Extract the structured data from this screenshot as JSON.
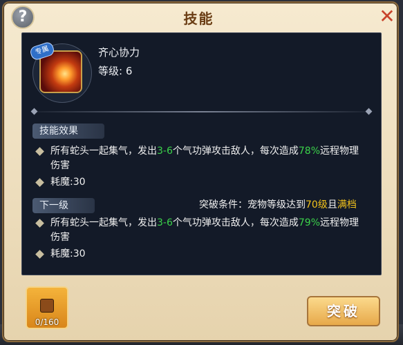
{
  "window": {
    "title": "技能",
    "help_label": "?",
    "close_label": "✕"
  },
  "skill": {
    "badge": "专属",
    "name": "齐心协力",
    "level_label": "等级: 6"
  },
  "sections": {
    "effect": {
      "label": "技能效果",
      "desc_prefix": "所有蛇头一起集气，发出",
      "desc_range": "3-6",
      "desc_mid": "个气功弹攻击敌人，每次造成",
      "desc_pct": "78%",
      "desc_suffix": "远程物理",
      "desc_line2": "伤害",
      "cost": "耗魔:30"
    },
    "next": {
      "label": "下一级",
      "cond_prefix": "突破条件：宠物等级达到",
      "cond_level": "70级",
      "cond_and": "且",
      "cond_full": "满档",
      "desc_prefix": "所有蛇头一起集气，发出",
      "desc_range": "3-6",
      "desc_mid": "个气功弹攻击敌人，每次造成",
      "desc_pct": "79%",
      "desc_suffix": "远程物理",
      "desc_line2": "伤害",
      "cost": "耗魔:30"
    }
  },
  "footer": {
    "item_count": "0/160",
    "break_label": "突破"
  },
  "colors": {
    "highlight_green": "#3bd24a",
    "highlight_yellow": "#f2c21c",
    "title_brown": "#6a3d14"
  }
}
